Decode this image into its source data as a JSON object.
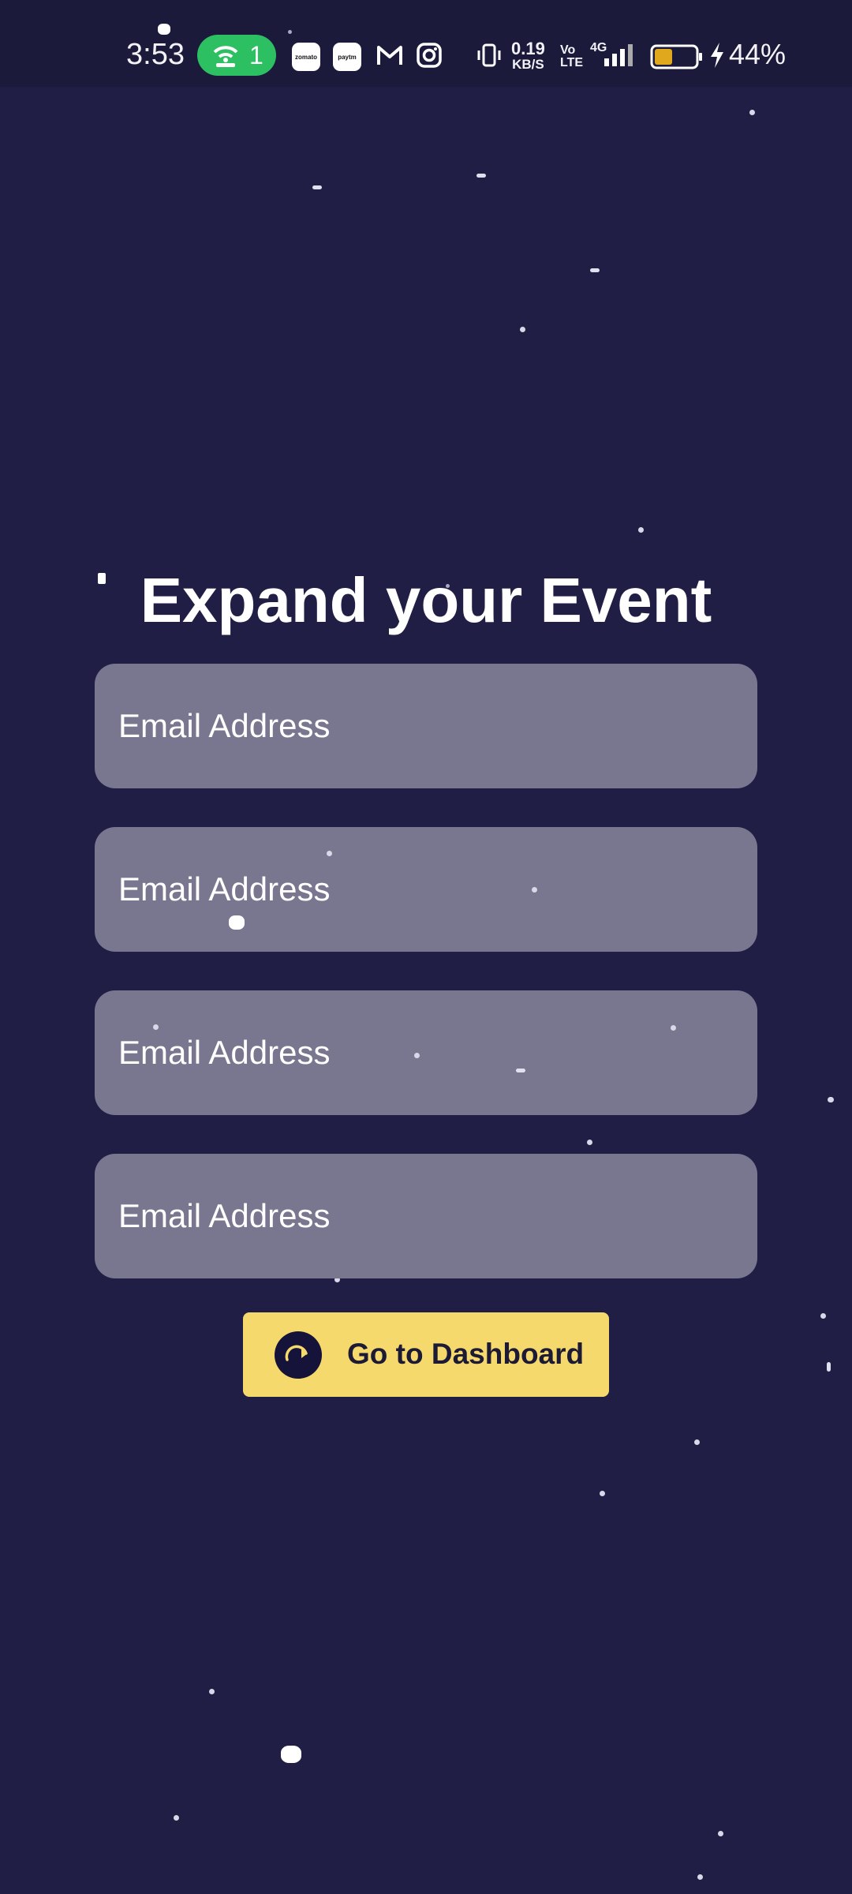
{
  "status_bar": {
    "time": "3:53",
    "hotspot_count": "1",
    "net_speed_value": "0.19",
    "net_speed_unit": "KB/S",
    "volte_top": "Vo",
    "volte_bottom": "LTE",
    "network_type": "4G",
    "battery_percent": "44%",
    "battery_level": 0.44,
    "app_icons": [
      "zomato",
      "paytm"
    ]
  },
  "page": {
    "title": "Expand your Event"
  },
  "form": {
    "fields": [
      {
        "placeholder": "Email Address"
      },
      {
        "placeholder": "Email Address"
      },
      {
        "placeholder": "Email Address"
      },
      {
        "placeholder": "Email Address"
      }
    ]
  },
  "actions": {
    "dashboard_label": "Go to Dashboard"
  },
  "colors": {
    "background": "#201e45",
    "field": "#78778f",
    "button": "#f6d96d",
    "hotspot": "#2cc063"
  }
}
